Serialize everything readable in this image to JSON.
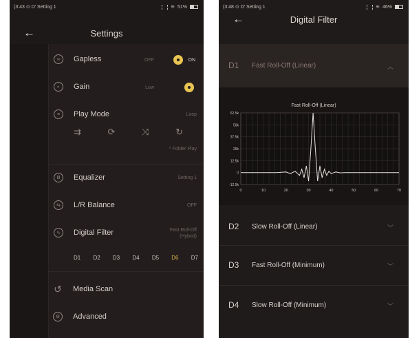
{
  "left": {
    "status": {
      "left_text": "(3:43 ⊙ D' Setting 1",
      "battery": "51%",
      "battery_level": 0.51
    },
    "title": "Settings",
    "gapless": {
      "label": "Gapless",
      "off": "OFF",
      "on": "ON"
    },
    "gain": {
      "label": "Gain",
      "value": "Low"
    },
    "play_mode": {
      "label": "Play Mode",
      "value": "Loop",
      "sub": "* Folder Play"
    },
    "equalizer": {
      "label": "Equalizer",
      "value": "Setting 1"
    },
    "lr_balance": {
      "label": "L/R Balance",
      "value": "OFF"
    },
    "digital_filter": {
      "label": "Digital Filter",
      "value_line1": "Fast Roll-Off",
      "value_line2": "(Hybrid)"
    },
    "filter_buttons": [
      "D1",
      "D2",
      "D3",
      "D4",
      "D5",
      "D6",
      "D7"
    ],
    "active_filter": "D6",
    "media_scan": {
      "label": "Media Scan"
    },
    "advanced": {
      "label": "Advanced"
    }
  },
  "right": {
    "status": {
      "left_text": "(3:48 ⊙ D' Setting 1",
      "battery": "46%",
      "battery_level": 0.46
    },
    "title": "Digital Filter",
    "items": [
      {
        "code": "D1",
        "name": "Fast Roll-Off (Linear)"
      },
      {
        "code": "D2",
        "name": "Slow Roll-Off (Linear)"
      },
      {
        "code": "D3",
        "name": "Fast Roll-Off (Minimum)"
      },
      {
        "code": "D4",
        "name": "Slow Roll-Off (Minimum)"
      }
    ]
  },
  "chart_data": {
    "type": "line",
    "title": "Fast Roll-Off (Linear)",
    "x_ticks": [
      0,
      10,
      20,
      30,
      40,
      50,
      60,
      70
    ],
    "y_tick_labels": [
      "62.5k",
      "50k",
      "37.5k",
      "25k",
      "12.5k",
      "0",
      "-12.5k"
    ],
    "y_tick_values": [
      62500,
      50000,
      37500,
      25000,
      12500,
      0,
      -12500
    ],
    "xlim": [
      0,
      70
    ],
    "ylim": [
      -12500,
      62500
    ],
    "grid": true,
    "series": [
      {
        "color": "#e8e3df",
        "x": [
          0,
          16,
          20,
          22,
          24,
          26,
          27,
          28,
          29,
          30,
          31,
          32,
          33,
          34,
          35,
          36,
          37,
          38,
          39,
          40,
          42,
          44,
          46,
          50,
          70
        ],
        "y": [
          0,
          0,
          600,
          -1200,
          1500,
          -3000,
          3500,
          -5500,
          7000,
          -9000,
          25000,
          62500,
          25000,
          -9000,
          7000,
          -5500,
          3500,
          -3000,
          1500,
          -1200,
          600,
          -300,
          0,
          0,
          0
        ]
      }
    ]
  }
}
